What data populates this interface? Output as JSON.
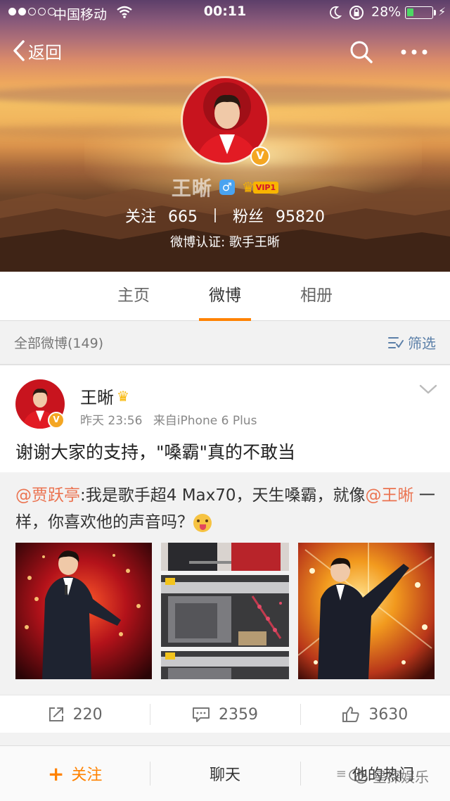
{
  "status_bar": {
    "carrier": "中国移动",
    "time": "00:11",
    "battery_percent": "28%",
    "battery_level": 0.28
  },
  "nav": {
    "back_label": "返回"
  },
  "profile": {
    "name": "王晰",
    "vip_label": "VIP1",
    "following_label": "关注",
    "following_count": "665",
    "followers_label": "粉丝",
    "followers_count": "95820",
    "verification": "微博认证: 歌手王晰"
  },
  "tabs": [
    {
      "label": "主页",
      "active": false
    },
    {
      "label": "微博",
      "active": true
    },
    {
      "label": "相册",
      "active": false
    }
  ],
  "filter": {
    "count_label": "全部微博(149)",
    "filter_label": "筛选"
  },
  "post": {
    "author": "王晰",
    "time": "昨天 23:56",
    "source": "来自iPhone 6 Plus",
    "text": "谢谢大家的支持，\"嗓霸\"真的不敢当",
    "repost": {
      "mention_author": "@贾跃亭",
      "text_1": ":我是歌手超4 Max70，天生嗓霸，就像",
      "mention_target": "@王晰",
      "text_2": " 一样，你喜欢他的声音吗？"
    },
    "actions": {
      "repost_count": "220",
      "comment_count": "2359",
      "like_count": "3630"
    }
  },
  "bottom_bar": {
    "follow_label": "关注",
    "chat_label": "聊天",
    "hot_label": "他的热门"
  },
  "watermark": "星探娱乐",
  "colors": {
    "accent": "#ff8200",
    "mention": "#eb7350",
    "verify_badge": "#f4a623",
    "vip_gold": "#f8b500"
  }
}
